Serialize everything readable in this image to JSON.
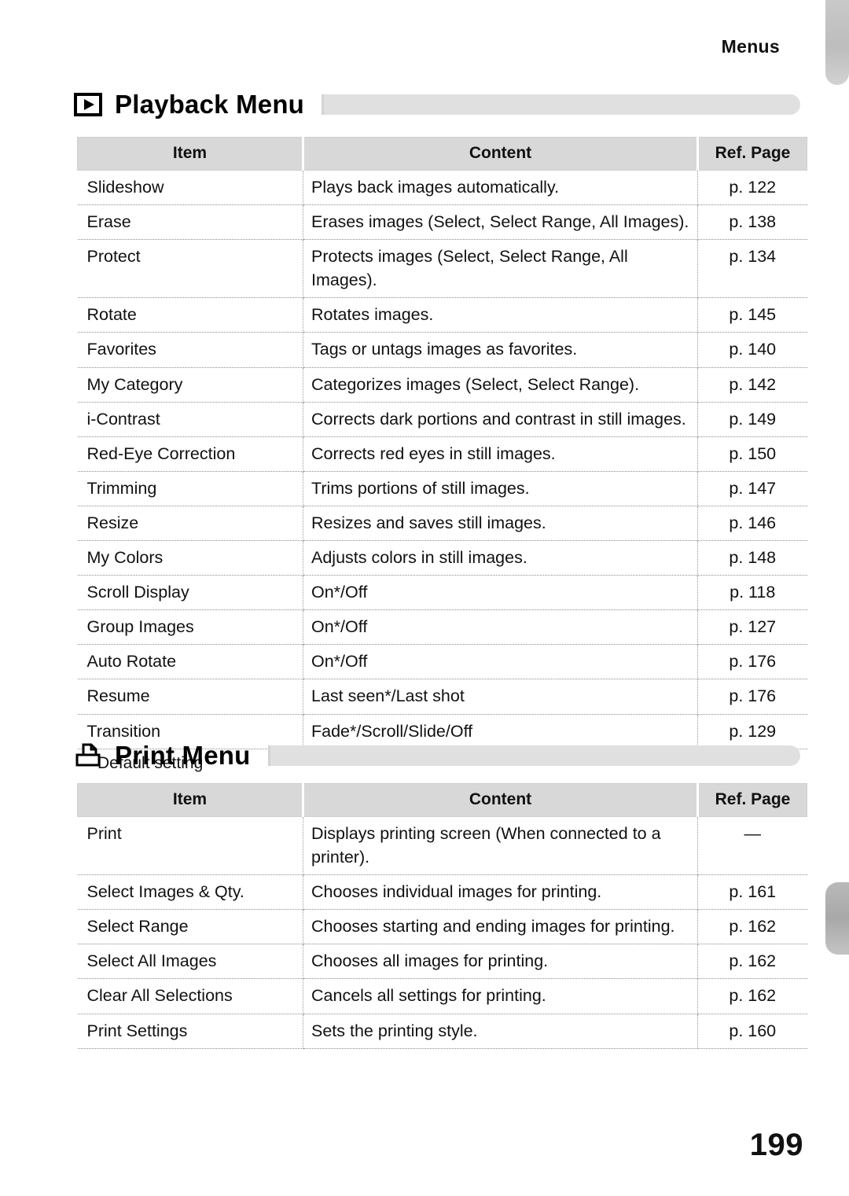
{
  "page": {
    "running_head": "Menus",
    "page_number": "199",
    "footnote": "Default setting",
    "footnote_marker": "*"
  },
  "columns": {
    "item": "Item",
    "content": "Content",
    "ref_page": "Ref. Page"
  },
  "sections": [
    {
      "id": "playback",
      "title": "Playback Menu",
      "icon": "play-icon",
      "rows": [
        {
          "item": "Slideshow",
          "content": "Plays back images automatically.",
          "ref": "p. 122"
        },
        {
          "item": "Erase",
          "content": "Erases images (Select, Select Range, All Images).",
          "ref": "p. 138"
        },
        {
          "item": "Protect",
          "content": "Protects images (Select, Select Range, All Images).",
          "ref": "p. 134"
        },
        {
          "item": "Rotate",
          "content": "Rotates images.",
          "ref": "p. 145"
        },
        {
          "item": "Favorites",
          "content": "Tags or untags images as favorites.",
          "ref": "p. 140"
        },
        {
          "item": "My Category",
          "content": "Categorizes images (Select, Select Range).",
          "ref": "p. 142"
        },
        {
          "item": "i-Contrast",
          "content": "Corrects dark portions and contrast in still images.",
          "ref": "p. 149"
        },
        {
          "item": "Red-Eye Correction",
          "content": "Corrects red eyes in still images.",
          "ref": "p. 150"
        },
        {
          "item": "Trimming",
          "content": "Trims portions of still images.",
          "ref": "p. 147"
        },
        {
          "item": "Resize",
          "content": "Resizes and saves still images.",
          "ref": "p. 146"
        },
        {
          "item": "My Colors",
          "content": "Adjusts colors in still images.",
          "ref": "p. 148"
        },
        {
          "item": "Scroll Display",
          "content": "On*/Off",
          "ref": "p. 118"
        },
        {
          "item": "Group Images",
          "content": "On*/Off",
          "ref": "p. 127"
        },
        {
          "item": "Auto Rotate",
          "content": "On*/Off",
          "ref": "p. 176"
        },
        {
          "item": "Resume",
          "content": "Last seen*/Last shot",
          "ref": "p. 176"
        },
        {
          "item": "Transition",
          "content": "Fade*/Scroll/Slide/Off",
          "ref": "p. 129"
        }
      ]
    },
    {
      "id": "print",
      "title": "Print Menu",
      "icon": "printer-icon",
      "rows": [
        {
          "item": "Print",
          "content": "Displays printing screen (When connected to a printer).",
          "ref": "—"
        },
        {
          "item": "Select Images & Qty.",
          "content": "Chooses individual images for printing.",
          "ref": "p. 161"
        },
        {
          "item": "Select Range",
          "content": "Chooses starting and ending images for printing.",
          "ref": "p. 162"
        },
        {
          "item": "Select All Images",
          "content": "Chooses all images for printing.",
          "ref": "p. 162"
        },
        {
          "item": "Clear All Selections",
          "content": "Cancels all settings for printing.",
          "ref": "p. 162"
        },
        {
          "item": "Print Settings",
          "content": "Sets the printing style.",
          "ref": "p. 160"
        }
      ]
    }
  ]
}
